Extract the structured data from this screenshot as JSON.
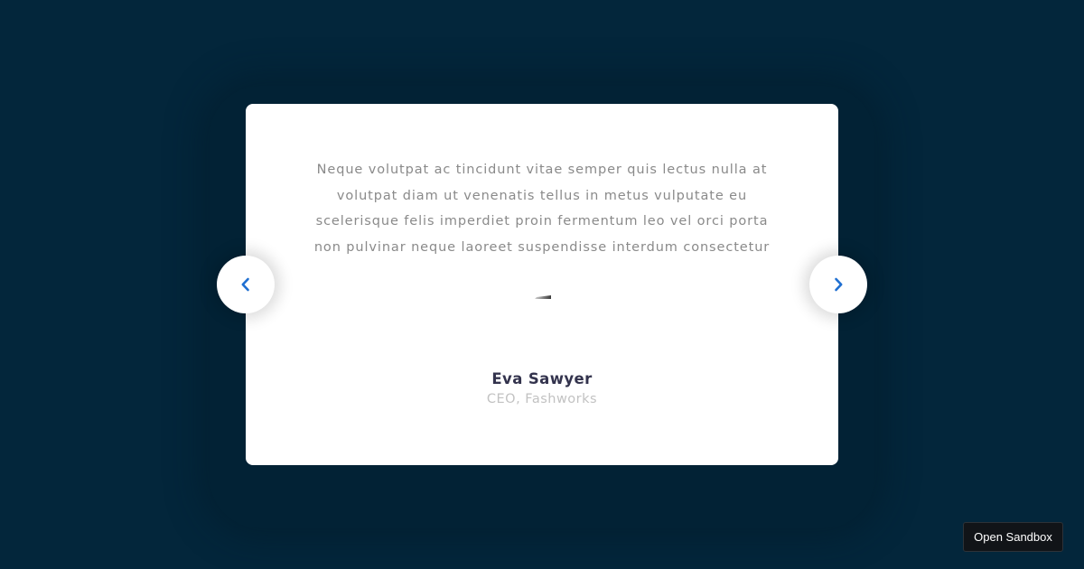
{
  "testimonial": {
    "quote": "Neque volutpat ac tincidunt vitae semper quis lectus nulla at volutpat diam ut venenatis tellus in metus vulputate eu scelerisque felis imperdiet proin fermentum leo vel orci porta non pulvinar neque laoreet suspendisse interdum consectetur",
    "author_name": "Eva Sawyer",
    "author_role": "CEO, Fashworks"
  },
  "navigation": {
    "prev_icon": "chevron-left-icon",
    "next_icon": "chevron-right-icon"
  },
  "sandbox": {
    "label": "Open Sandbox"
  },
  "colors": {
    "background": "#03263b",
    "card": "#ffffff",
    "accent": "#1f6fd1",
    "quote_text": "#8a8a8a",
    "name_text": "#33334d",
    "role_text": "#c2c2c2"
  }
}
